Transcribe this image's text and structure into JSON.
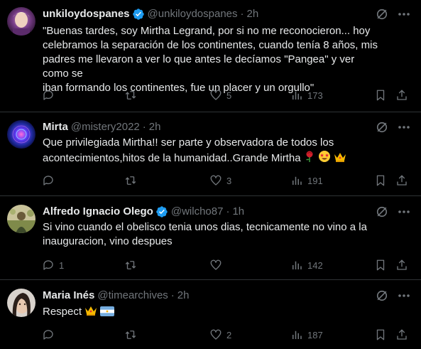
{
  "tweets": [
    {
      "name": "unkiloydospanes",
      "verified": true,
      "handle": "@unkiloydospanes",
      "time": "2h",
      "lines": [
        "\"Buenas tardes, soy Mirtha Legrand, por si no me reconocieron... hoy",
        "celebramos la separación de los continentes, cuando tenía 8 años, mis",
        "padres me llevaron a ver lo que antes le decíamos \"Pangea\" y ver como se",
        "iban formando los continentes, fue un placer y un orgullo\""
      ],
      "replies": "",
      "retweets": "",
      "likes": "5",
      "views": "173"
    },
    {
      "name": "Mirta",
      "verified": false,
      "handle": "@mistery2022",
      "time": "2h",
      "lines": [
        "Que privilegiada Mirtha!! ser parte y observadora de todos los",
        "acontecimientos,hitos de la humanidad..Grande Mirtha"
      ],
      "replies": "",
      "retweets": "",
      "likes": "3",
      "views": "191"
    },
    {
      "name": "Alfredo Ignacio Olego",
      "verified": true,
      "handle": "@wilcho87",
      "time": "1h",
      "lines": [
        "Si vino cuando el obelisco tenia unos dias, tecnicamente no vino a la",
        "inauguracion, vino despues"
      ],
      "replies": "1",
      "retweets": "",
      "likes": "",
      "views": "142"
    },
    {
      "name": "Maria Inés",
      "verified": false,
      "handle": "@timearchives",
      "time": "2h",
      "lines": [
        "Respect"
      ],
      "replies": "",
      "retweets": "",
      "likes": "2",
      "views": "187"
    }
  ],
  "colors": {
    "background": "#000000",
    "text": "#e7e9ea",
    "muted": "#71767b",
    "divider": "#2f3336",
    "verified": "#1d9bf0"
  },
  "icons": [
    "reply-icon",
    "retweet-icon",
    "like-icon",
    "views-icon",
    "bookmark-icon",
    "share-icon",
    "grok-icon",
    "more-icon",
    "verified-icon"
  ]
}
